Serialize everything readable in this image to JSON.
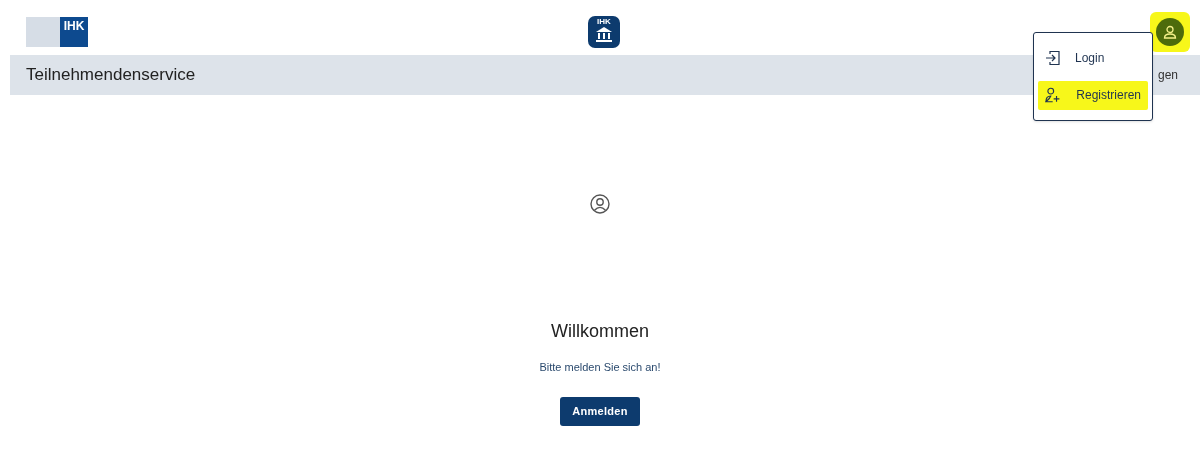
{
  "header": {
    "logo_text": "IHK",
    "app_icon_text": "IHK",
    "avatar": {
      "highlighted": true
    }
  },
  "nav_bar": {
    "title": "Teilnehmendenservice",
    "right_text": "gen"
  },
  "user_menu": {
    "items": [
      {
        "kind": "login",
        "label": "Login",
        "highlighted": false
      },
      {
        "kind": "register",
        "label": "Registrieren",
        "highlighted": true
      }
    ]
  },
  "main": {
    "heading": "Willkommen",
    "message": "Bitte melden Sie sich an!",
    "button": "Anmelden"
  }
}
